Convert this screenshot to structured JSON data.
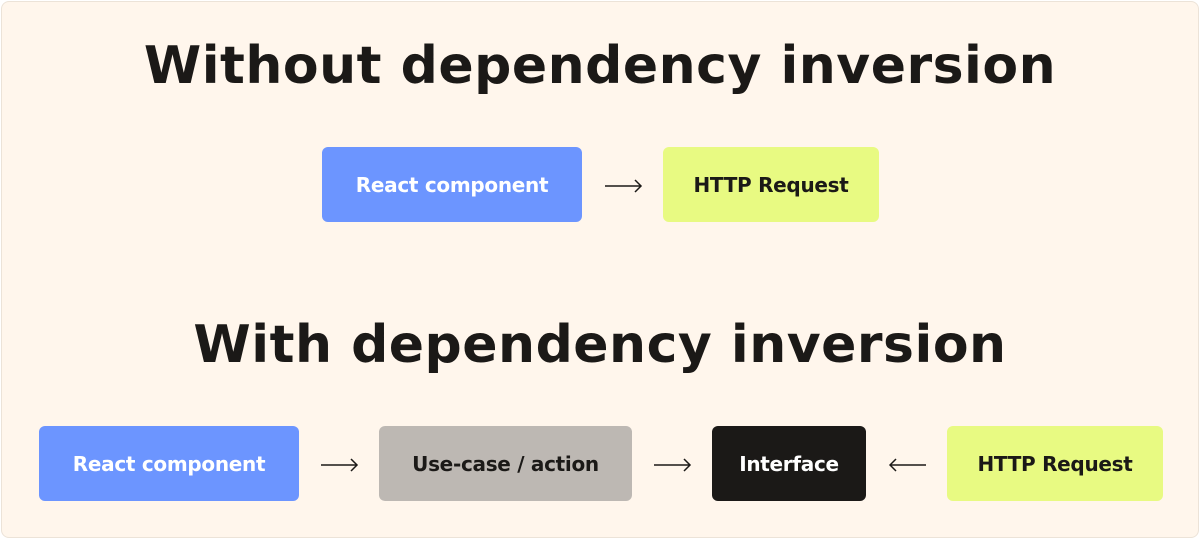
{
  "title_without": "Without dependency inversion",
  "title_with": "With dependency inversion",
  "without": {
    "react_component": "React component",
    "http_request": "HTTP Request"
  },
  "with": {
    "react_component": "React component",
    "use_case": "Use-case / action",
    "interface": "Interface",
    "http_request": "HTTP Request"
  },
  "colors": {
    "background": "#fff6ec",
    "react": "#6c95ff",
    "http": "#e8fa82",
    "usecase": "#bdb8b3",
    "interface": "#1b1917",
    "text": "#1b1917"
  }
}
